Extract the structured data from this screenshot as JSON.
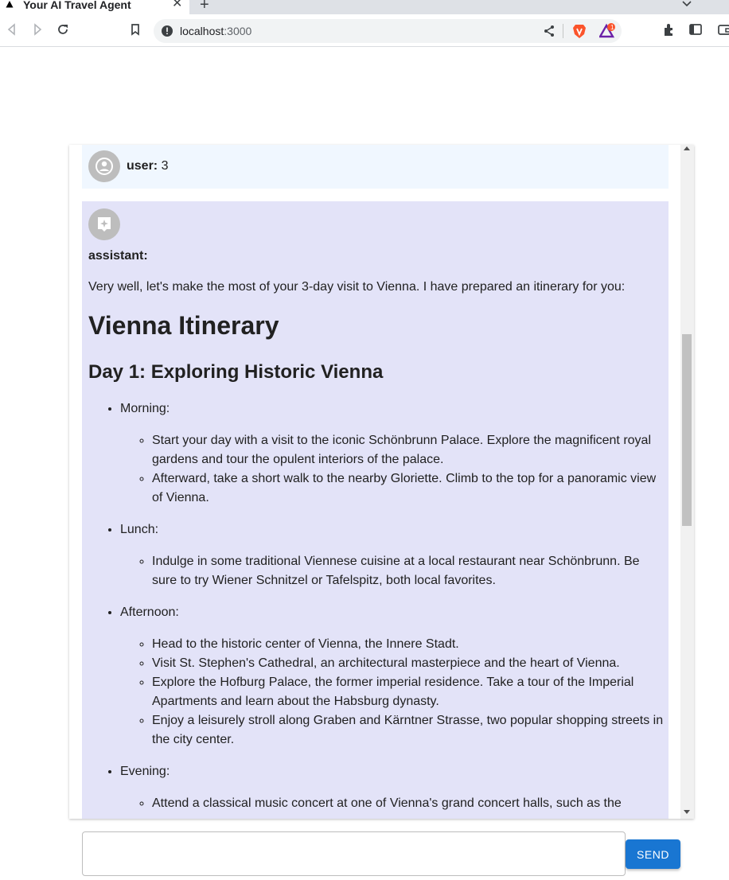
{
  "browser": {
    "tab_title": "Your AI Travel Agent",
    "tab_close": "✕",
    "new_tab": "+",
    "url_host": "localhost",
    "url_port": ":3000",
    "icons": [
      "back-icon",
      "forward-icon",
      "reload-icon",
      "bookmark-icon",
      "site-info-icon",
      "share-icon",
      "brave-shields-icon",
      "brave-rewards-icon",
      "extensions-icon",
      "sidebar-icon",
      "wallet-icon"
    ],
    "rewards_badge": "1"
  },
  "chat": {
    "user_message": {
      "role": "user:",
      "text": "3"
    },
    "assistant_message": {
      "role": "assistant:",
      "intro": "Very well, let's make the most of your 3-day visit to Vienna. I have prepared an itinerary for you:",
      "heading": "Vienna Itinerary",
      "day_heading": "Day 1: Exploring Historic Vienna",
      "sections": [
        {
          "label": "Morning:",
          "items": [
            "Start your day with a visit to the iconic Schönbrunn Palace. Explore the magnificent royal gardens and tour the opulent interiors of the palace.",
            "Afterward, take a short walk to the nearby Gloriette. Climb to the top for a panoramic view of Vienna."
          ]
        },
        {
          "label": "Lunch:",
          "items": [
            "Indulge in some traditional Viennese cuisine at a local restaurant near Schönbrunn. Be sure to try Wiener Schnitzel or Tafelspitz, both local favorites."
          ]
        },
        {
          "label": "Afternoon:",
          "items": [
            "Head to the historic center of Vienna, the Innere Stadt.",
            "Visit St. Stephen's Cathedral, an architectural masterpiece and the heart of Vienna.",
            "Explore the Hofburg Palace, the former imperial residence. Take a tour of the Imperial Apartments and learn about the Habsburg dynasty.",
            "Enjoy a leisurely stroll along Graben and Kärntner Strasse, two popular shopping streets in the city center."
          ]
        },
        {
          "label": "Evening:",
          "items": [
            "Attend a classical music concert at one of Vienna's grand concert halls, such as the"
          ]
        }
      ]
    }
  },
  "composer": {
    "input_value": "",
    "send_label": "SEND"
  },
  "colors": {
    "user_bg": "#f0f7ff",
    "assistant_bg": "#e3e3f8",
    "send_button": "#1976d2",
    "avatar": "#bdbdbd"
  }
}
